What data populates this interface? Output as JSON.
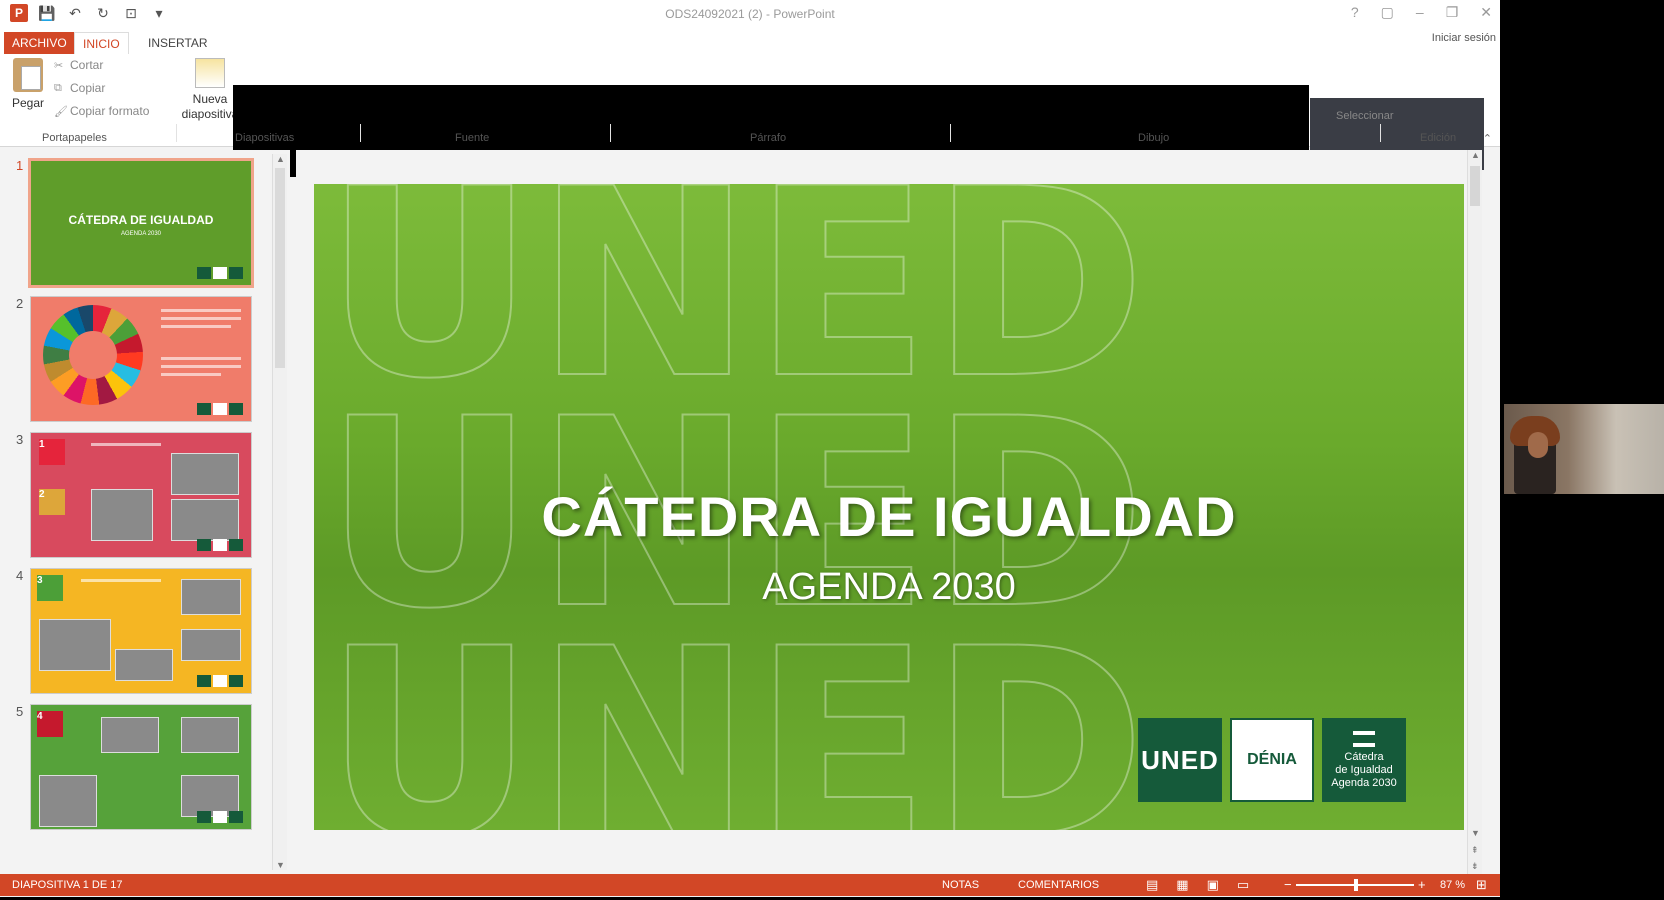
{
  "window": {
    "title": "ODS24092021 (2) - PowerPoint",
    "controls": [
      "?",
      "▢",
      "–",
      "❐",
      "✕"
    ]
  },
  "tabs": {
    "archivo": "ARCHIVO",
    "inicio": "INICIO",
    "insertar": "INSERTAR",
    "signin": "Iniciar sesión"
  },
  "ribbon": {
    "pegar": "Pegar",
    "cortar": "Cortar",
    "copiar": "Copiar",
    "copiar_formato": "Copiar formato",
    "nueva_line1": "Nueva",
    "nueva_line2": "diapositiva",
    "seleccionar": "Seleccionar",
    "groups": {
      "portapapeles": "Portapapeles",
      "diapositivas": "Diapositivas",
      "fuente": "Fuente",
      "parrafo": "Párrafo",
      "dibujo": "Dibujo",
      "edicion": "Edición"
    }
  },
  "thumbnails": [
    {
      "number": "1",
      "title": "CÁTEDRA DE IGUALDAD",
      "subtitle": "AGENDA 2030",
      "color": "#5f9d2a"
    },
    {
      "number": "2",
      "color": "#f07c6a"
    },
    {
      "number": "3",
      "color": "#d84a5e"
    },
    {
      "number": "4",
      "color": "#f5b623"
    },
    {
      "number": "5",
      "color": "#56a23a"
    }
  ],
  "slide": {
    "title": "CÁTEDRA DE IGUALDAD",
    "subtitle": "AGENDA 2030",
    "watermark": "UNED",
    "logos": {
      "uned": "UNED",
      "denia": "DÉNIA",
      "catedra_line1": "Cátedra",
      "catedra_line2": "de Igualdad",
      "catedra_line3": "Agenda 2030"
    },
    "background": "#6aaa2c"
  },
  "status": {
    "slide_indicator": "DIAPOSITIVA 1 DE 17",
    "notes": "NOTAS",
    "comments": "COMENTARIOS",
    "zoom": "87 %",
    "accent": "#d24726"
  }
}
